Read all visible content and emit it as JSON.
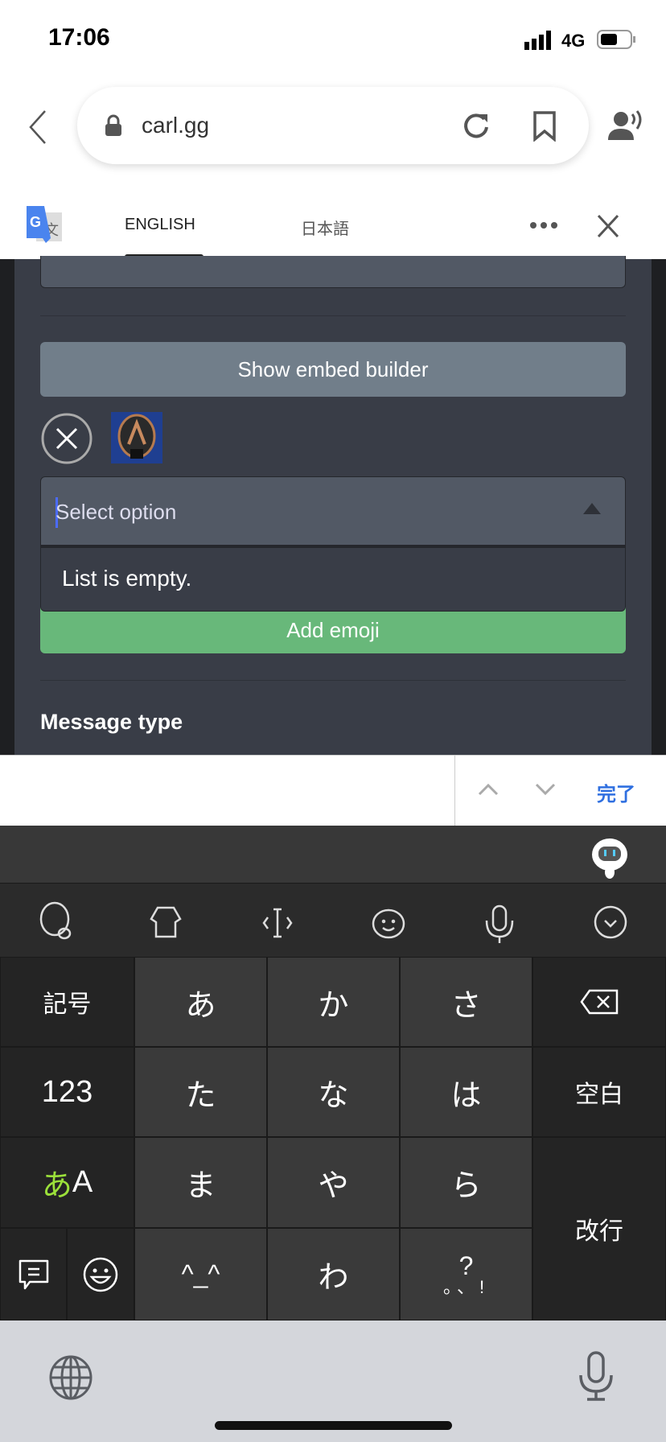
{
  "status": {
    "time": "17:06",
    "network": "4G",
    "battery_level": 0.6
  },
  "browser": {
    "url": "carl.gg"
  },
  "translate": {
    "tabs": [
      "ENGLISH",
      "日本語"
    ],
    "active_tab": 0
  },
  "page": {
    "embed_button": "Show embed builder",
    "select_placeholder": "Select option",
    "dropdown_empty": "List is empty.",
    "add_emoji": "Add emoji",
    "message_type": "Message type"
  },
  "accessory": {
    "done": "完了"
  },
  "keyboard": {
    "keys": {
      "kigo": "記号",
      "a": "あ",
      "ka": "か",
      "sa": "さ",
      "num": "123",
      "ta": "た",
      "na": "な",
      "ha": "は",
      "space": "空白",
      "kana_a": "あ",
      "kana_A": "A",
      "ma": "ま",
      "ya": "や",
      "ra": "ら",
      "enter": "改行",
      "face": "^_^",
      "wa": "わ",
      "punct_top": "?",
      "punct_bottom": "。、!"
    }
  },
  "colors": {
    "green": "#68b87a",
    "embed": "#717e8a",
    "done": "#2f6fe0",
    "kana_green": "#9be03a"
  }
}
